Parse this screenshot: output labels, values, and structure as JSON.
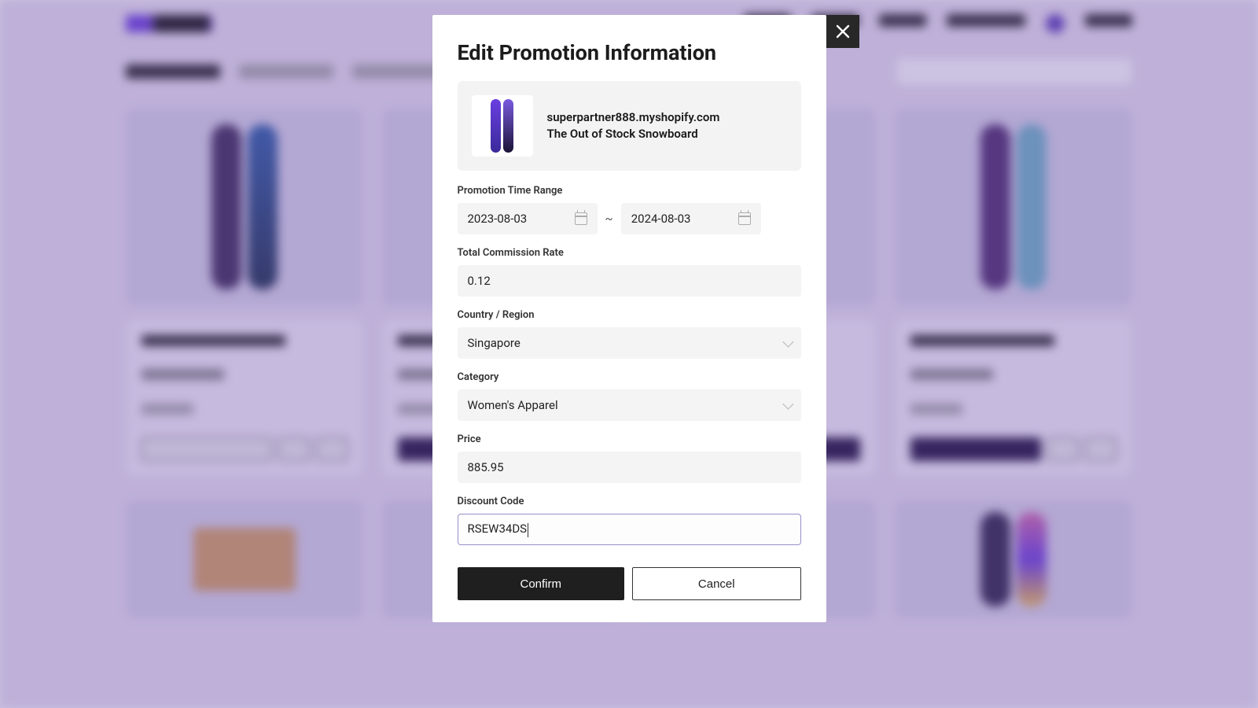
{
  "modal": {
    "title": "Edit Promotion Information",
    "product": {
      "domain": "superpartner888.myshopify.com",
      "name": "The Out of Stock Snowboard"
    },
    "fields": {
      "timeRange": {
        "label": "Promotion Time Range",
        "start": "2023-08-03",
        "end": "2024-08-03",
        "separator": "~"
      },
      "commission": {
        "label": "Total Commission Rate",
        "value": "0.12"
      },
      "country": {
        "label": "Country / Region",
        "value": "Singapore"
      },
      "category": {
        "label": "Category",
        "value": "Women's Apparel"
      },
      "price": {
        "label": "Price",
        "value": "885.95"
      },
      "discountCode": {
        "label": "Discount Code",
        "value": "RSEW34DS"
      }
    },
    "buttons": {
      "confirm": "Confirm",
      "cancel": "Cancel"
    }
  }
}
